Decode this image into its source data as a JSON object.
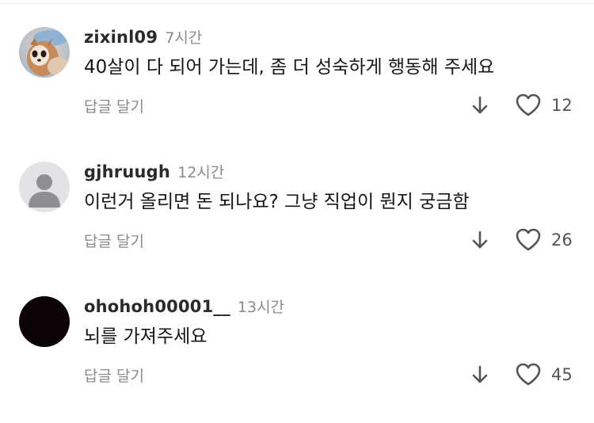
{
  "comments": [
    {
      "username": "zixinl09",
      "time": "7시간",
      "text": "40살이 다 되어 가는데, 좀 더 성숙하게 행동해 주세요",
      "reply_label": "답글 달기",
      "like_count": "12",
      "avatar": "photo-avatar"
    },
    {
      "username": "gjhruugh",
      "time": "12시간",
      "text": "이런거 올리면 돈 되나요? 그냥 직업이 뭔지 궁금함",
      "reply_label": "답글 달기",
      "like_count": "26",
      "avatar": "default-avatar"
    },
    {
      "username": "ohohoh00001__",
      "time": "13시간",
      "text": "뇌를 가져주세요",
      "reply_label": "답글 달기",
      "like_count": "45",
      "avatar": "black-avatar"
    }
  ],
  "icons": {
    "dislike": "arrow-down-icon",
    "like": "heart-outline-icon"
  },
  "colors": {
    "text": "#161616",
    "muted": "#8a8a8a",
    "icon": "#555555"
  }
}
